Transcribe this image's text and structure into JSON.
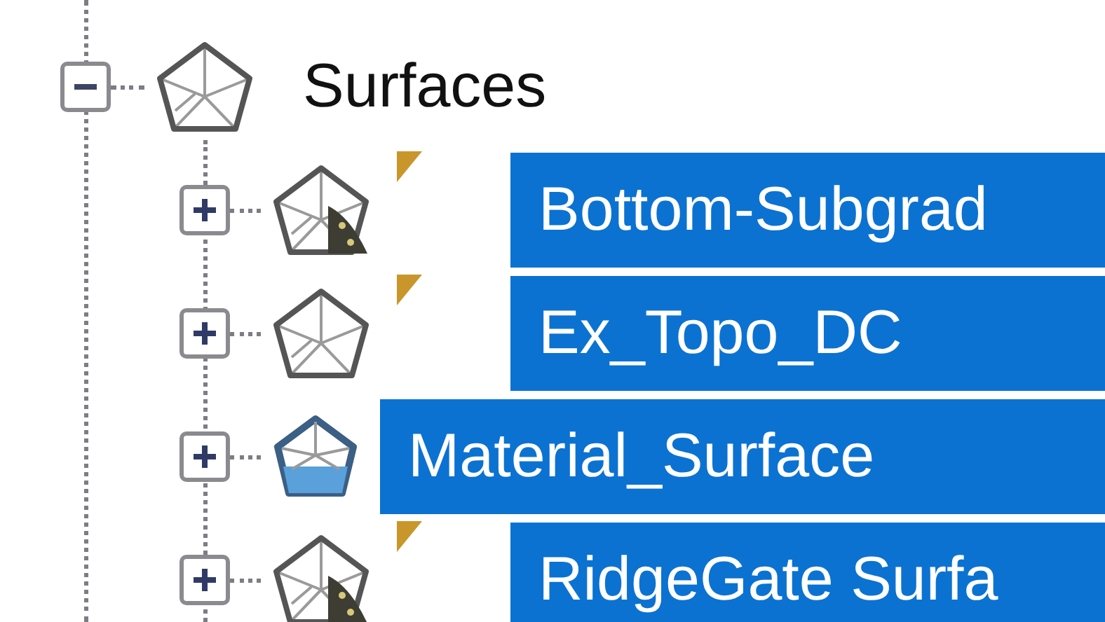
{
  "tree": {
    "label": "Surfaces",
    "kind": "surface",
    "expanded": true,
    "selected": false,
    "children": [
      {
        "label": "Bottom-Subgrad",
        "kind": "surface_road",
        "flagged": true,
        "expanded": false,
        "selected": true
      },
      {
        "label": "Ex_Topo_DC",
        "kind": "surface",
        "flagged": true,
        "expanded": false,
        "selected": true
      },
      {
        "label": "Material_Surface",
        "kind": "material",
        "flagged": false,
        "expanded": false,
        "selected": true
      },
      {
        "label": "RidgeGate Surfa",
        "kind": "surface_road",
        "flagged": true,
        "expanded": false,
        "selected": true
      }
    ]
  }
}
